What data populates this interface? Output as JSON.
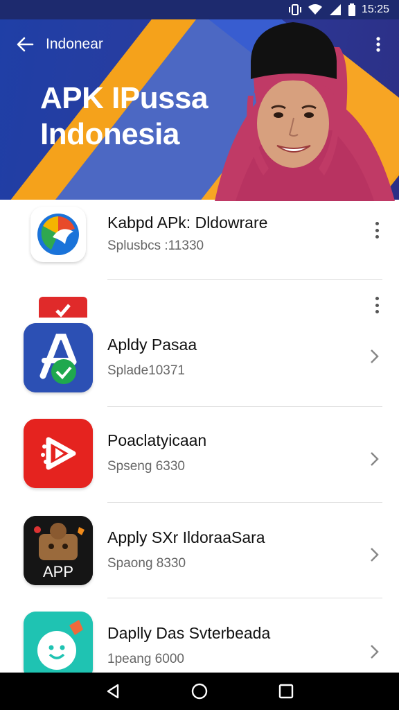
{
  "status_bar": {
    "time": "15:25"
  },
  "appbar": {
    "title": "Indonear"
  },
  "hero": {
    "title_line1": "APK IPussa",
    "title_line2": "Indonesia"
  },
  "list": [
    {
      "title": "Kabpd APk: Dldowrare",
      "subtitle": "Splusbcs :11330",
      "trailing": "more"
    },
    {
      "title": "",
      "subtitle": "",
      "trailing": "more"
    },
    {
      "title": "Apldy Pasaa",
      "subtitle": "Splade10371",
      "trailing": "chevron"
    },
    {
      "title": "Poaclatyicaan",
      "subtitle": "Spseng 6330",
      "trailing": "chevron"
    },
    {
      "title": "Apply SXr IldoraaSara",
      "subtitle": "Spaong 8330",
      "icon_label": "APP",
      "trailing": "chevron"
    },
    {
      "title": "Daplly Das Svterbeada",
      "subtitle": "1peang 6000",
      "trailing": "chevron"
    }
  ],
  "colors": {
    "header_blue": "#1f3fa6",
    "accent_orange": "#f5a21b",
    "status_bar": "#1d2a6e",
    "navbar": "#000000"
  },
  "icons": [
    "back-arrow-icon",
    "more-vert-icon",
    "chevron-right-icon",
    "nav-back-icon",
    "nav-home-icon",
    "nav-recents-icon"
  ]
}
